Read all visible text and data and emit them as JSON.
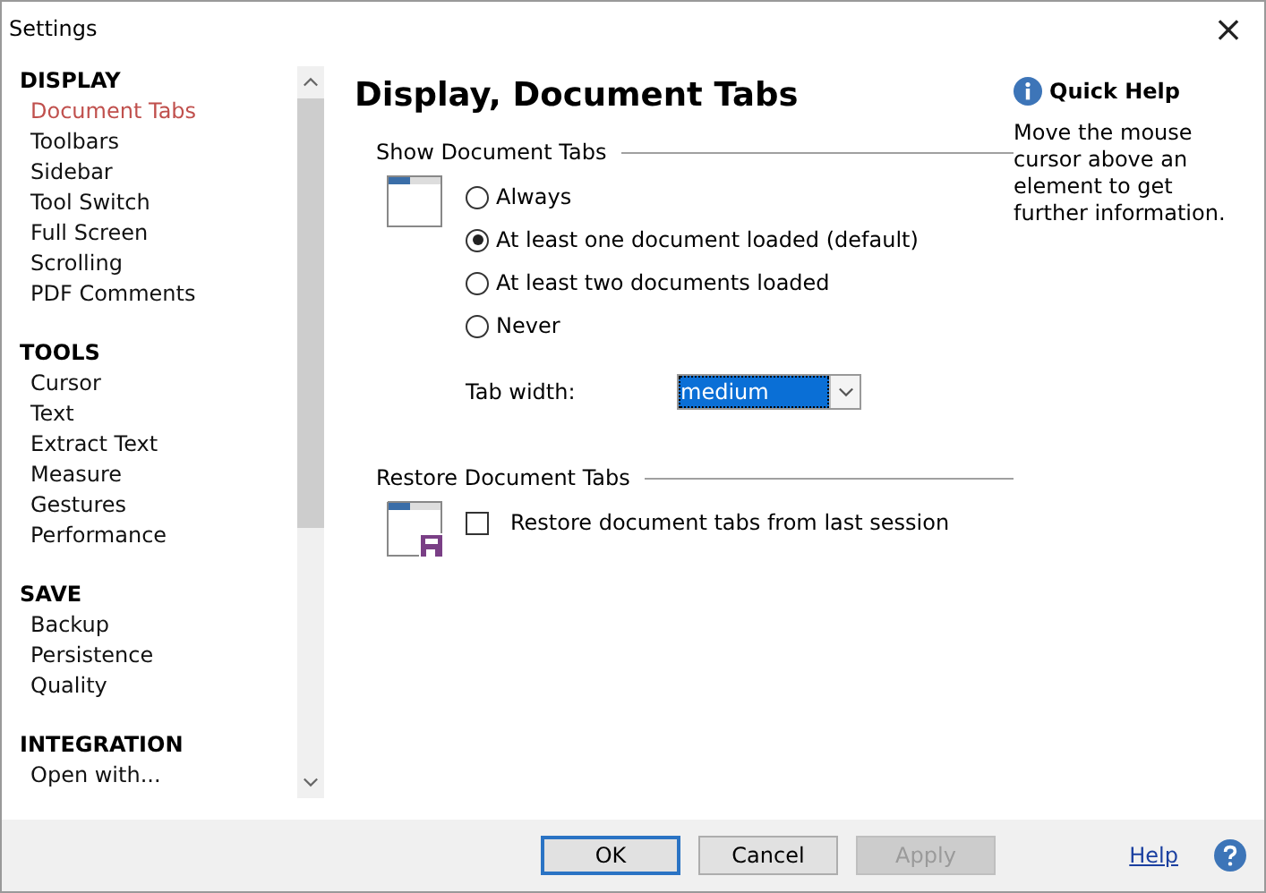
{
  "window": {
    "title": "Settings",
    "close": "×"
  },
  "sidebar": {
    "groups": [
      {
        "title": "DISPLAY",
        "items": [
          {
            "label": "Document Tabs",
            "selected": true
          },
          {
            "label": "Toolbars",
            "selected": false
          },
          {
            "label": "Sidebar",
            "selected": false
          },
          {
            "label": "Tool Switch",
            "selected": false
          },
          {
            "label": "Full Screen",
            "selected": false
          },
          {
            "label": "Scrolling",
            "selected": false
          },
          {
            "label": "PDF Comments",
            "selected": false
          }
        ]
      },
      {
        "title": "TOOLS",
        "items": [
          {
            "label": "Cursor",
            "selected": false
          },
          {
            "label": "Text",
            "selected": false
          },
          {
            "label": "Extract Text",
            "selected": false
          },
          {
            "label": "Measure",
            "selected": false
          },
          {
            "label": "Gestures",
            "selected": false
          },
          {
            "label": "Performance",
            "selected": false
          }
        ]
      },
      {
        "title": "SAVE",
        "items": [
          {
            "label": "Backup",
            "selected": false
          },
          {
            "label": "Persistence",
            "selected": false
          },
          {
            "label": "Quality",
            "selected": false
          }
        ]
      },
      {
        "title": "INTEGRATION",
        "items": [
          {
            "label": "Open with...",
            "selected": false
          }
        ]
      }
    ]
  },
  "page": {
    "title": "Display, Document Tabs",
    "sections": [
      {
        "title": "Show Document Tabs",
        "kind": "radios",
        "options": [
          {
            "label": "Always",
            "selected": false
          },
          {
            "label": "At least one document loaded (default)",
            "selected": true
          },
          {
            "label": "At least two documents loaded",
            "selected": false
          },
          {
            "label": "Never",
            "selected": false
          }
        ],
        "dropdown": {
          "label": "Tab width:",
          "value": "medium"
        }
      },
      {
        "title": "Restore Document Tabs",
        "kind": "checkbox",
        "option": {
          "label": "Restore document tabs from last session",
          "checked": false
        }
      }
    ]
  },
  "quick_help": {
    "title": "Quick Help",
    "text": "Move the mouse cursor above an element to get further information."
  },
  "buttons": [
    {
      "label": "OK",
      "default": true,
      "disabled": false
    },
    {
      "label": "Cancel",
      "default": false,
      "disabled": false
    },
    {
      "label": "Apply",
      "default": false,
      "disabled": true
    }
  ],
  "help_link": "Help"
}
